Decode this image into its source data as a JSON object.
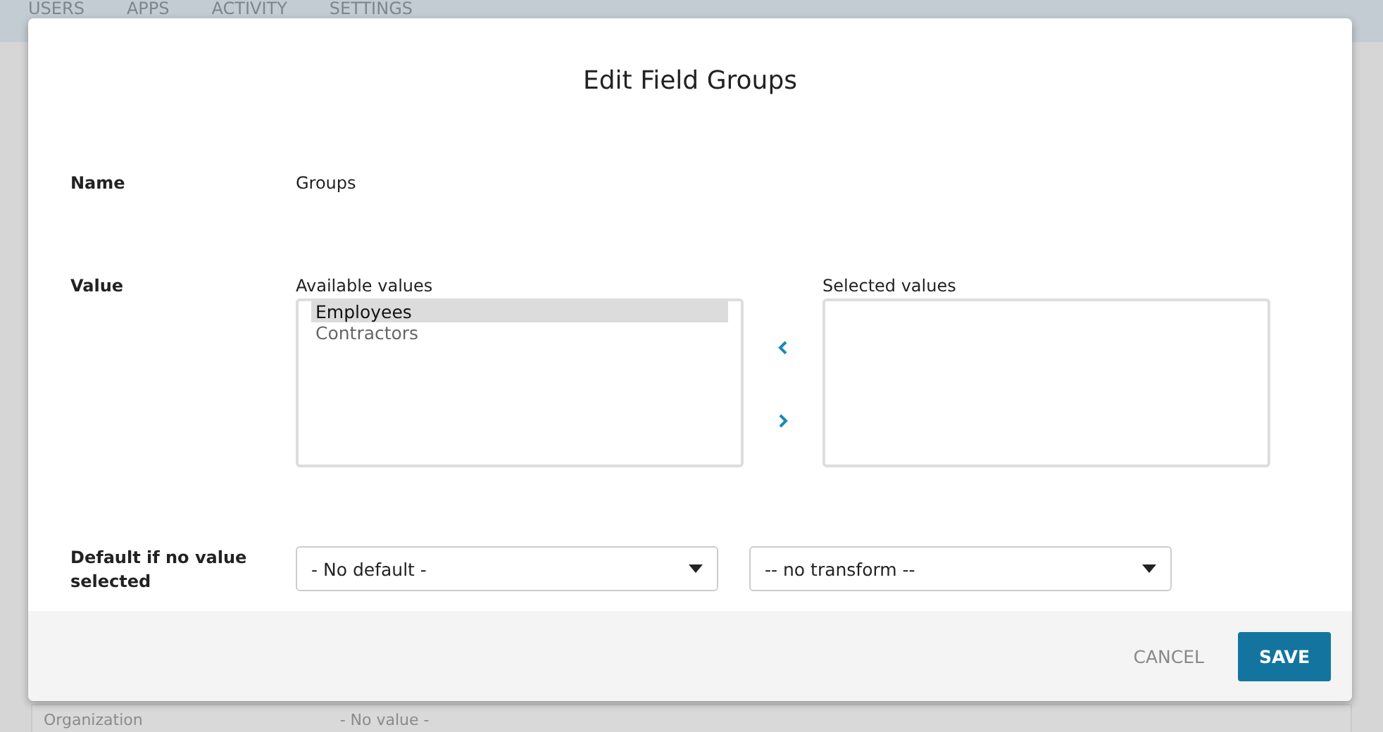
{
  "nav": {
    "tabs": [
      {
        "label": "USERS"
      },
      {
        "label": "APPS"
      },
      {
        "label": "ACTIVITY"
      },
      {
        "label": "SETTINGS"
      }
    ]
  },
  "background_row": {
    "label": "Organization",
    "value": "- No value -"
  },
  "dialog": {
    "title": "Edit Field Groups",
    "name": {
      "label": "Name",
      "value": "Groups"
    },
    "value": {
      "label": "Value",
      "available_label": "Available values",
      "selected_label": "Selected values",
      "available": [
        {
          "text": "Employees",
          "selected": true
        },
        {
          "text": "Contractors",
          "selected": false
        }
      ]
    },
    "default": {
      "label": "Default if no value selected",
      "default_select": "- No default -",
      "transform_select": "-- no transform --"
    },
    "buttons": [
      {
        "label": "CANCEL",
        "kind": "secondary"
      },
      {
        "label": "SAVE",
        "kind": "primary"
      }
    ]
  }
}
